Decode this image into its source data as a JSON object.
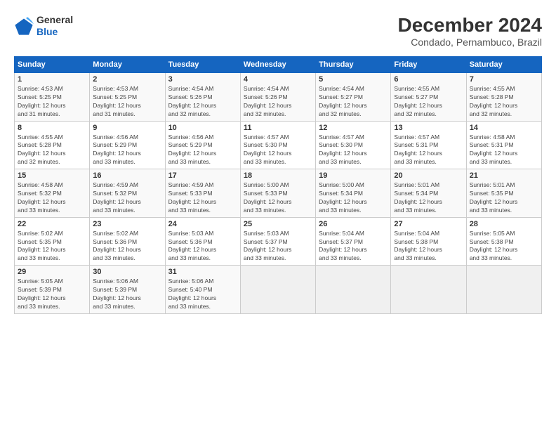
{
  "logo": {
    "line1": "General",
    "line2": "Blue"
  },
  "title": "December 2024",
  "subtitle": "Condado, Pernambuco, Brazil",
  "weekdays": [
    "Sunday",
    "Monday",
    "Tuesday",
    "Wednesday",
    "Thursday",
    "Friday",
    "Saturday"
  ],
  "weeks": [
    [
      {
        "day": "1",
        "info": "Sunrise: 4:53 AM\nSunset: 5:25 PM\nDaylight: 12 hours\nand 31 minutes."
      },
      {
        "day": "2",
        "info": "Sunrise: 4:53 AM\nSunset: 5:25 PM\nDaylight: 12 hours\nand 31 minutes."
      },
      {
        "day": "3",
        "info": "Sunrise: 4:54 AM\nSunset: 5:26 PM\nDaylight: 12 hours\nand 32 minutes."
      },
      {
        "day": "4",
        "info": "Sunrise: 4:54 AM\nSunset: 5:26 PM\nDaylight: 12 hours\nand 32 minutes."
      },
      {
        "day": "5",
        "info": "Sunrise: 4:54 AM\nSunset: 5:27 PM\nDaylight: 12 hours\nand 32 minutes."
      },
      {
        "day": "6",
        "info": "Sunrise: 4:55 AM\nSunset: 5:27 PM\nDaylight: 12 hours\nand 32 minutes."
      },
      {
        "day": "7",
        "info": "Sunrise: 4:55 AM\nSunset: 5:28 PM\nDaylight: 12 hours\nand 32 minutes."
      }
    ],
    [
      {
        "day": "8",
        "info": "Sunrise: 4:55 AM\nSunset: 5:28 PM\nDaylight: 12 hours\nand 32 minutes."
      },
      {
        "day": "9",
        "info": "Sunrise: 4:56 AM\nSunset: 5:29 PM\nDaylight: 12 hours\nand 33 minutes."
      },
      {
        "day": "10",
        "info": "Sunrise: 4:56 AM\nSunset: 5:29 PM\nDaylight: 12 hours\nand 33 minutes."
      },
      {
        "day": "11",
        "info": "Sunrise: 4:57 AM\nSunset: 5:30 PM\nDaylight: 12 hours\nand 33 minutes."
      },
      {
        "day": "12",
        "info": "Sunrise: 4:57 AM\nSunset: 5:30 PM\nDaylight: 12 hours\nand 33 minutes."
      },
      {
        "day": "13",
        "info": "Sunrise: 4:57 AM\nSunset: 5:31 PM\nDaylight: 12 hours\nand 33 minutes."
      },
      {
        "day": "14",
        "info": "Sunrise: 4:58 AM\nSunset: 5:31 PM\nDaylight: 12 hours\nand 33 minutes."
      }
    ],
    [
      {
        "day": "15",
        "info": "Sunrise: 4:58 AM\nSunset: 5:32 PM\nDaylight: 12 hours\nand 33 minutes."
      },
      {
        "day": "16",
        "info": "Sunrise: 4:59 AM\nSunset: 5:32 PM\nDaylight: 12 hours\nand 33 minutes."
      },
      {
        "day": "17",
        "info": "Sunrise: 4:59 AM\nSunset: 5:33 PM\nDaylight: 12 hours\nand 33 minutes."
      },
      {
        "day": "18",
        "info": "Sunrise: 5:00 AM\nSunset: 5:33 PM\nDaylight: 12 hours\nand 33 minutes."
      },
      {
        "day": "19",
        "info": "Sunrise: 5:00 AM\nSunset: 5:34 PM\nDaylight: 12 hours\nand 33 minutes."
      },
      {
        "day": "20",
        "info": "Sunrise: 5:01 AM\nSunset: 5:34 PM\nDaylight: 12 hours\nand 33 minutes."
      },
      {
        "day": "21",
        "info": "Sunrise: 5:01 AM\nSunset: 5:35 PM\nDaylight: 12 hours\nand 33 minutes."
      }
    ],
    [
      {
        "day": "22",
        "info": "Sunrise: 5:02 AM\nSunset: 5:35 PM\nDaylight: 12 hours\nand 33 minutes."
      },
      {
        "day": "23",
        "info": "Sunrise: 5:02 AM\nSunset: 5:36 PM\nDaylight: 12 hours\nand 33 minutes."
      },
      {
        "day": "24",
        "info": "Sunrise: 5:03 AM\nSunset: 5:36 PM\nDaylight: 12 hours\nand 33 minutes."
      },
      {
        "day": "25",
        "info": "Sunrise: 5:03 AM\nSunset: 5:37 PM\nDaylight: 12 hours\nand 33 minutes."
      },
      {
        "day": "26",
        "info": "Sunrise: 5:04 AM\nSunset: 5:37 PM\nDaylight: 12 hours\nand 33 minutes."
      },
      {
        "day": "27",
        "info": "Sunrise: 5:04 AM\nSunset: 5:38 PM\nDaylight: 12 hours\nand 33 minutes."
      },
      {
        "day": "28",
        "info": "Sunrise: 5:05 AM\nSunset: 5:38 PM\nDaylight: 12 hours\nand 33 minutes."
      }
    ],
    [
      {
        "day": "29",
        "info": "Sunrise: 5:05 AM\nSunset: 5:39 PM\nDaylight: 12 hours\nand 33 minutes."
      },
      {
        "day": "30",
        "info": "Sunrise: 5:06 AM\nSunset: 5:39 PM\nDaylight: 12 hours\nand 33 minutes."
      },
      {
        "day": "31",
        "info": "Sunrise: 5:06 AM\nSunset: 5:40 PM\nDaylight: 12 hours\nand 33 minutes."
      },
      null,
      null,
      null,
      null
    ]
  ]
}
